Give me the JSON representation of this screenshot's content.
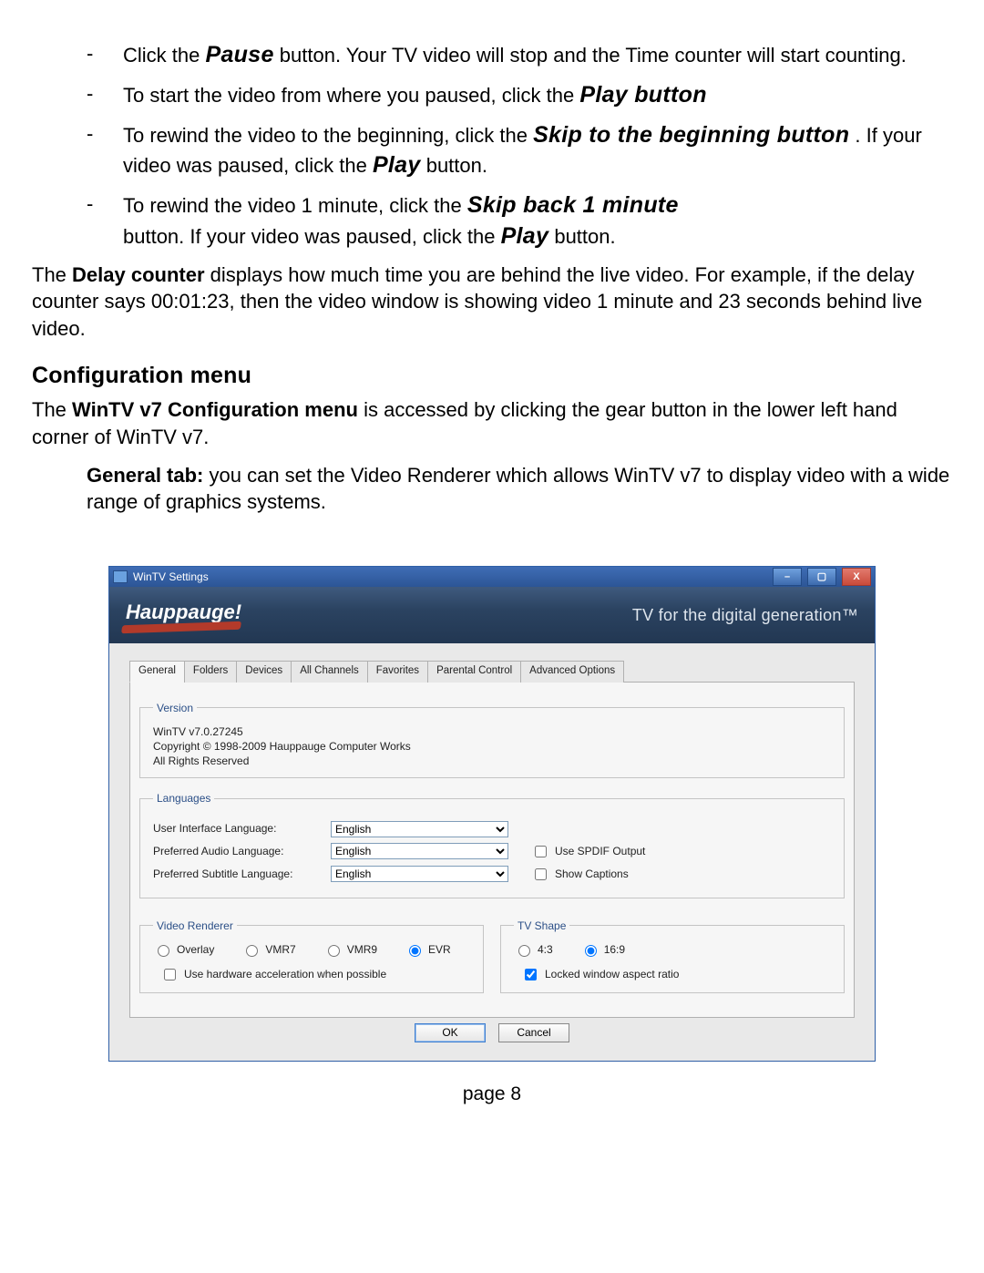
{
  "doc": {
    "bullets": {
      "pause_pre": "Click the ",
      "pause_b": "Pause",
      "pause_post": " button. Your TV video will stop and the Time counter will start counting.",
      "play_pre": "To start the video from where you paused, click the ",
      "play_b": "Play button",
      "skip_beg_pre": "To rewind the video to the beginning, click the ",
      "skip_beg_b": "Skip to the beginning button",
      "skip_beg_post1": ". If your video was paused, click the ",
      "skip_beg_play": "Play",
      "skip_beg_post2": " button.",
      "skip1_pre": "To rewind the video 1 minute, click the ",
      "skip1_b": "Skip back 1 minute",
      "skip1_line2a": "button. If your video was paused, click the ",
      "skip1_play": "Play",
      "skip1_line2b": " button."
    },
    "delay_p1a": "The ",
    "delay_p1b": "Delay counter",
    "delay_p1c": " displays how much time you are behind the live video. For example, if the delay counter says 00:01:23, then the video window is showing video 1 minute and 23 seconds behind live video.",
    "config_heading": "Configuration menu",
    "config_p1a": "The ",
    "config_p1b": "WinTV v7 Configuration menu",
    "config_p1c": " is accessed by clicking the gear button in the lower left hand corner of WinTV v7.",
    "general_p_a": "General tab:",
    "general_p_b": " you can set the Video Renderer which allows WinTV v7 to display video with a wide range of graphics systems.",
    "page_footer": "page 8"
  },
  "dlg": {
    "title": "WinTV Settings",
    "brand": "Hauppauge!",
    "slogan": "TV for the digital generation™",
    "tabs": [
      "General",
      "Folders",
      "Devices",
      "All Channels",
      "Favorites",
      "Parental Control",
      "Advanced Options"
    ],
    "version": {
      "legend": "Version",
      "line1": "WinTV v7.0.27245",
      "line2": "Copyright © 1998-2009  Hauppauge Computer Works",
      "line3": "All Rights Reserved"
    },
    "lang": {
      "legend": "Languages",
      "ui_label": "User Interface Language:",
      "ui_value": "English",
      "audio_label": "Preferred Audio Language:",
      "audio_value": "English",
      "sub_label": "Preferred Subtitle Language:",
      "sub_value": "English",
      "spdif": "Use SPDIF Output",
      "captions": "Show Captions"
    },
    "vr": {
      "legend": "Video Renderer",
      "overlay": "Overlay",
      "vmr7": "VMR7",
      "vmr9": "VMR9",
      "evr": "EVR",
      "hwaccel": "Use hardware acceleration when possible"
    },
    "shape": {
      "legend": "TV Shape",
      "r43": "4:3",
      "r169": "16:9",
      "lock": "Locked window aspect ratio"
    },
    "ok": "OK",
    "cancel": "Cancel"
  }
}
